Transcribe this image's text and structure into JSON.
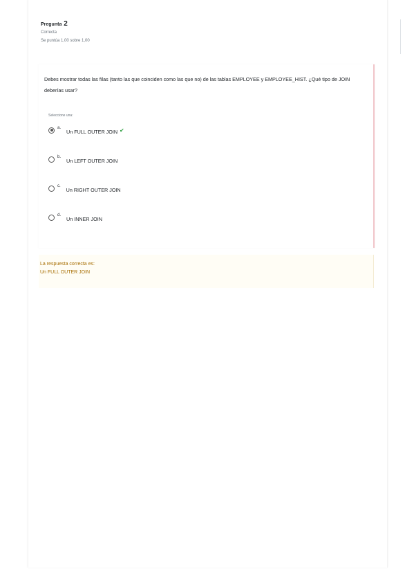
{
  "question_info": {
    "label": "Pregunta",
    "number": "2",
    "state": "Correcta",
    "grade": "Se puntúa 1,00 sobre 1,00"
  },
  "question": {
    "text": "Debes mostrar todas las filas (tanto las que coinciden como las que no) de las tablas EMPLOYEE y EMPLOYEE_HIST. ¿Qué tipo de JOIN deberías usar?",
    "prompt": "Seleccione una:",
    "options": [
      {
        "letter": "a.",
        "text": "Un FULL OUTER JOIN",
        "checked": true,
        "correct_mark": "✔"
      },
      {
        "letter": "b.",
        "text": "Un LEFT OUTER JOIN",
        "checked": false
      },
      {
        "letter": "c.",
        "text": "Un RIGHT OUTER JOIN",
        "checked": false
      },
      {
        "letter": "d.",
        "text": "Un INNER JOIN",
        "checked": false
      }
    ]
  },
  "feedback": {
    "right_answer_label": "La respuesta correcta es:",
    "right_answer_value": "Un FULL OUTER JOIN"
  },
  "colors": {
    "correct_check": "#2a9d3d",
    "feedback_text": "#a86f04",
    "question_border": "#f1c4c9"
  }
}
